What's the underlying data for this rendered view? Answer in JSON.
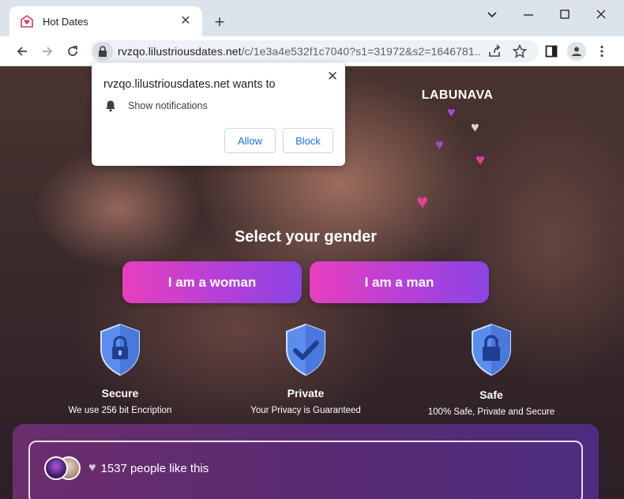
{
  "browser": {
    "tab": {
      "title": "Hot Dates"
    },
    "address_bar": {
      "host": "rvzqo.lilustriousdates.net",
      "path": "/c/1e3a4e532f1c7040?s1=31972&s2=1646781..."
    }
  },
  "permission_popup": {
    "title": "rvzqo.lilustriousdates.net wants to",
    "permission": "Show notifications",
    "allow_label": "Allow",
    "block_label": "Block"
  },
  "page": {
    "brand": "LABUNAVA",
    "gender_prompt": "Select your gender",
    "buttons": {
      "woman": "I am a woman",
      "man": "I am a man"
    },
    "features": [
      {
        "title": "Secure",
        "desc": "We use 256 bit Encription"
      },
      {
        "title": "Private",
        "desc": "Your Privacy is Guaranteed"
      },
      {
        "title": "Safe",
        "desc": "100% Safe, Private and Secure"
      }
    ],
    "likes_text": "1537 people like this"
  },
  "colors": {
    "cta_start": "#e83fbd",
    "cta_end": "#8a44e4",
    "shield": "#5b8def",
    "heart_purple": "#a348d0",
    "heart_pink": "#e0408f",
    "heart_beige": "#e6cfc4"
  },
  "icons": [
    "mail-heart-icon",
    "close-icon",
    "plus-icon",
    "back-arrow-icon",
    "forward-arrow-icon",
    "reload-icon",
    "lock-icon",
    "share-icon",
    "star-icon",
    "sidebar-icon",
    "profile-icon",
    "more-menu-icon",
    "bell-icon",
    "shield-lock-icon",
    "shield-check-icon",
    "heart-icon"
  ]
}
